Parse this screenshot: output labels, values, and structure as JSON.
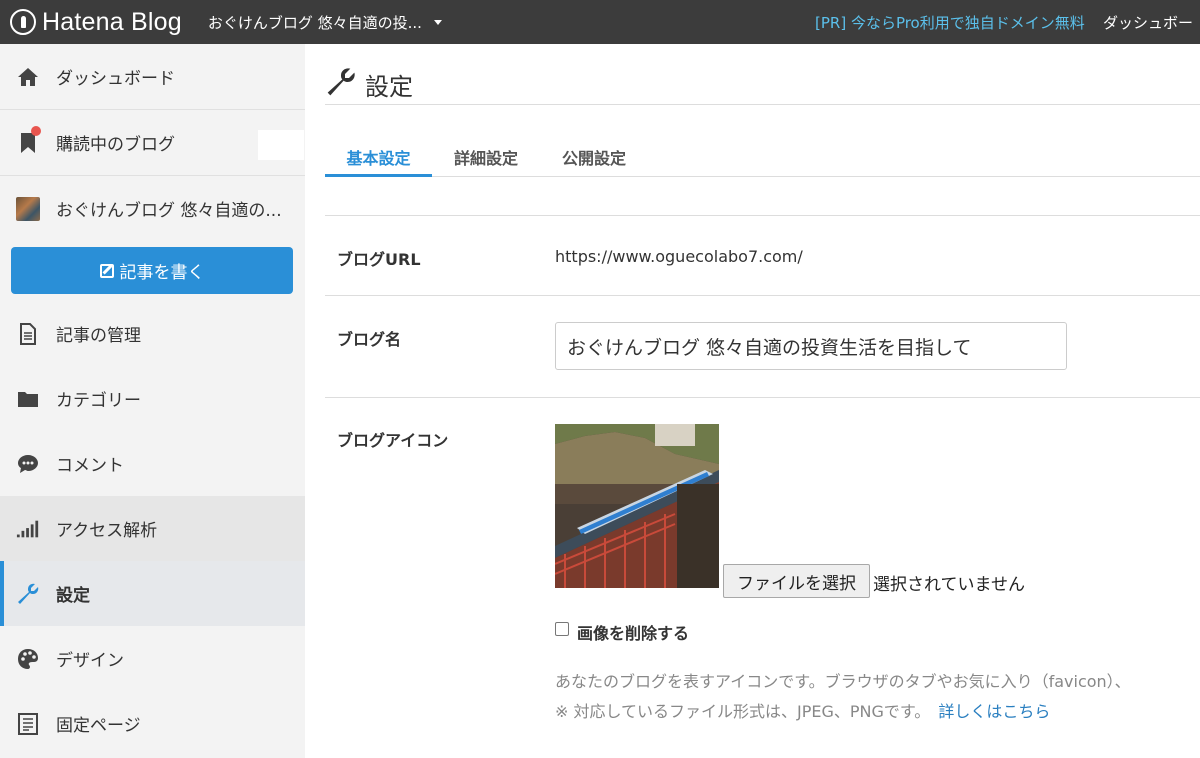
{
  "header": {
    "logo_text": "Hatena Blog",
    "blog_selector": "おぐけんブログ 悠々自適の投...",
    "pr_link": "[PR] 今ならPro利用で独自ドメイン無料",
    "dashboard_link": "ダッシュボー"
  },
  "sidebar": {
    "items": [
      {
        "label": "ダッシュボード",
        "icon": "home-icon"
      },
      {
        "label": "購読中のブログ",
        "icon": "bookmark-icon"
      },
      {
        "label": "おぐけんブログ 悠々自適の...",
        "icon": "blog-thumbnail"
      },
      {
        "label": "記事の管理",
        "icon": "document-icon"
      },
      {
        "label": "カテゴリー",
        "icon": "folder-icon"
      },
      {
        "label": "コメント",
        "icon": "comment-icon"
      },
      {
        "label": "アクセス解析",
        "icon": "bar-chart-icon"
      },
      {
        "label": "設定",
        "icon": "wrench-icon"
      },
      {
        "label": "デザイン",
        "icon": "palette-icon"
      },
      {
        "label": "固定ページ",
        "icon": "page-icon"
      }
    ],
    "write_button": "記事を書く"
  },
  "main": {
    "title": "設定",
    "tabs": [
      {
        "label": "基本設定",
        "active": true
      },
      {
        "label": "詳細設定",
        "active": false
      },
      {
        "label": "公開設定",
        "active": false
      }
    ],
    "blog_url": {
      "label": "ブログURL",
      "value": "https://www.oguecolabo7.com/"
    },
    "blog_name": {
      "label": "ブログ名",
      "value": "おぐけんブログ 悠々自適の投資生活を目指して"
    },
    "blog_icon": {
      "label": "ブログアイコン",
      "file_button": "ファイルを選択",
      "file_status": "選択されていません",
      "delete_label": "画像を削除する",
      "delete_checked": false,
      "help_line1": "あなたのブログを表すアイコンです。ブラウザのタブやお気に入り（favicon）、",
      "help_line2": "※ 対応しているファイル形式は、JPEG、PNGです。",
      "help_link": "詳しくはこちら"
    }
  },
  "colors": {
    "accent": "#2a8fd7",
    "topbar": "#3c3c3c",
    "pr_link": "#5bc0eb",
    "notification": "#e8554e"
  }
}
